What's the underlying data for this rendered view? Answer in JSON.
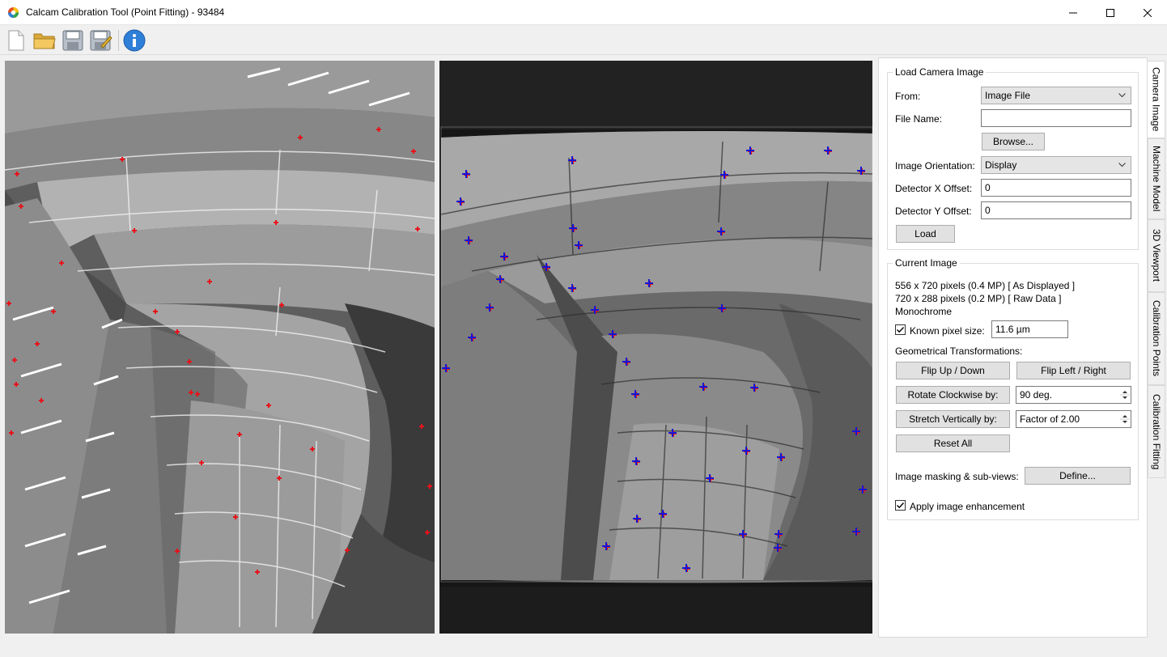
{
  "window": {
    "title": "Calcam Calibration Tool (Point Fitting) - 93484",
    "minimize_icon": "minimize-icon",
    "maximize_icon": "maximize-icon",
    "close_icon": "close-icon"
  },
  "toolbar": {
    "buttons": [
      "new-file-icon",
      "open-folder-icon",
      "save-icon",
      "save-as-icon",
      "info-icon"
    ]
  },
  "colors": {
    "model_points": "#e8121a",
    "image_points_blue": "#1515d6",
    "image_points_red": "#e01818",
    "info_blue": "#2f7fd8"
  },
  "load_camera_image": {
    "title": "Load Camera Image",
    "from_label": "From:",
    "from_value": "Image File",
    "file_name_label": "File Name:",
    "file_name_value": "",
    "browse_button": "Browse...",
    "orientation_label": "Image Orientation:",
    "orientation_value": "Display",
    "x_offset_label": "Detector X Offset:",
    "x_offset_value": "0",
    "y_offset_label": "Detector Y Offset:",
    "y_offset_value": "0",
    "load_button": "Load"
  },
  "current_image": {
    "title": "Current Image",
    "line1": "556 x 720 pixels (0.4 MP) [ As Displayed ]",
    "line2": "720 x 288 pixels (0.2 MP) [ Raw Data ]",
    "line3": "Monochrome",
    "known_pixel_size_label": "Known pixel size:",
    "known_pixel_size_checked": true,
    "known_pixel_size_value": "11.6 µm",
    "geometrical_label": "Geometrical Transformations:",
    "flip_ud_button": "Flip Up / Down",
    "flip_lr_button": "Flip Left / Right",
    "rotate_button": "Rotate Clockwise by:",
    "rotate_value": "90 deg.",
    "stretch_button": "Stretch Vertically by:",
    "stretch_value": "Factor of 2.00",
    "reset_button": "Reset All",
    "masking_label": "Image masking & sub-views:",
    "define_button": "Define...",
    "enhancement_label": "Apply image enhancement",
    "enhancement_checked": true
  },
  "tabs": [
    "Camera Image",
    "Machine Model",
    "3D Viewport",
    "Calibration Points",
    "Calibration Fitting"
  ]
}
